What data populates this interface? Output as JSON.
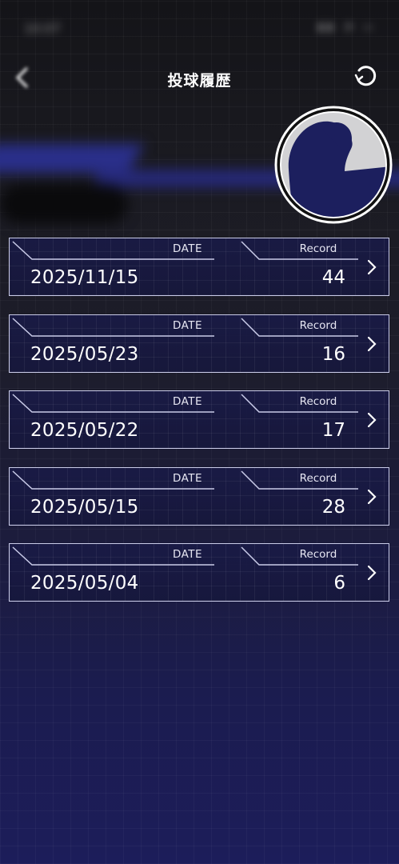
{
  "status_bar": {
    "time": "10:07",
    "icons": "▮▮ ◔ ▭"
  },
  "header": {
    "title": "投球履歴"
  },
  "records": {
    "date_label": "DATE",
    "record_label": "Record",
    "items": [
      {
        "date": "2025/11/15",
        "record": "44"
      },
      {
        "date": "2025/05/23",
        "record": "16"
      },
      {
        "date": "2025/05/22",
        "record": "17"
      },
      {
        "date": "2025/05/15",
        "record": "28"
      },
      {
        "date": "2025/05/04",
        "record": "6"
      }
    ]
  },
  "colors": {
    "card_border": "#c9cbe8",
    "card_bg": "#191a46",
    "avatar_fill": "#1c1f5e",
    "avatar_bg": "#d2d2d4"
  }
}
